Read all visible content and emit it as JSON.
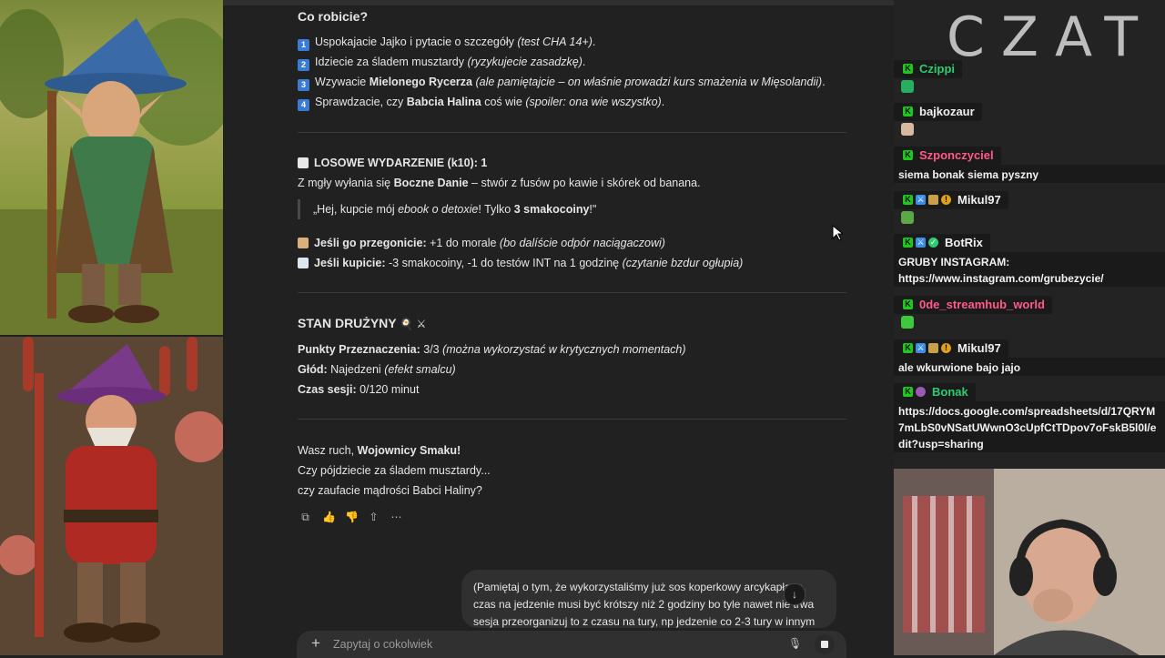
{
  "chat": {
    "section1_title": "Co robicie?",
    "options": [
      {
        "num": "1",
        "parts": [
          "Uspokajacie Jajko i pytacie o szczegóły ",
          "(test CHA 14+)",
          "."
        ]
      },
      {
        "num": "2",
        "parts": [
          "Idziecie za śladem musztardy ",
          "(ryzykujecie zasadzkę)",
          "."
        ]
      },
      {
        "num": "3",
        "pre": "Wzywacie ",
        "bold": "Mielonego Rycerza",
        "post": " ",
        "ital": "(ale pamiętajcie – on właśnie prowadzi kurs smażenia w Mięsolandii)",
        "end": "."
      },
      {
        "num": "4",
        "pre": "Sprawdzacie, czy ",
        "bold": "Babcia Halina",
        "post": " coś wie ",
        "ital": "(spoiler: ona wie wszystko)",
        "end": "."
      }
    ],
    "event_title": "LOSOWE WYDARZENIE (k10): 1",
    "event_line_pre": "Z mgły wyłania się ",
    "event_line_bold": "Boczne Danie",
    "event_line_post": " – stwór z fusów po kawie i skórek od banana.",
    "quote_pre": "„Hej, kupcie mój ",
    "quote_ital": "ebook o detoxie",
    "quote_mid": "! Tylko ",
    "quote_bold": "3 smakocoiny",
    "quote_end": "!\"",
    "if_chase_label": "Jeśli go przegonicie:",
    "if_chase_text": " +1 do morale ",
    "if_chase_ital": "(bo dalíście odpór naciągaczowi)",
    "if_buy_label": "Jeśli kupicie:",
    "if_buy_text": " -3 smakocoiny, -1 do testów INT na 1 godzinę ",
    "if_buy_ital": "(czytanie bzdur ogłupia)",
    "status_title": "STAN DRUŻYNY",
    "status_emoji": "🍳 ⚔",
    "fate_label": "Punkty Przeznaczenia:",
    "fate_value": " 3/3 ",
    "fate_ital": "(można wykorzystać w krytycznych momentach)",
    "hunger_label": "Głód:",
    "hunger_value": " Najedzeni ",
    "hunger_ital": "(efekt smalcu)",
    "session_label": "Czas sesji:",
    "session_value": " 0/120 minut",
    "closing_pre": "Wasz ruch, ",
    "closing_bold": "Wojownicy Smaku!",
    "closing_2": "Czy pójdziecie za śladem musztardy...",
    "closing_3": "czy zaufacie mądrości Babci Haliny?",
    "user_message": "(Pamiętaj o tym, że wykorzystaliśmy już sos koperkowy arcykapłana, czas na jedzenie musi być krótszy niż 2 godziny bo tyle nawet nie trwa sesja przeorganizuj to z czasu na tury, np jedzenie co 2-3 tury w innym",
    "composer_placeholder": "Zapytaj o cokolwiek",
    "scroll_arrow": "↓"
  },
  "side": {
    "header": "CZAT",
    "messages": [
      {
        "user": "Czippi",
        "color": "#2ecc71",
        "badges": [
          "k"
        ],
        "emote": "#27ae60",
        "text": ""
      },
      {
        "user": "bajkozaur",
        "color": "#f0f0f0",
        "badges": [
          "k"
        ],
        "emote": "#d8b8a0",
        "text": ""
      },
      {
        "user": "Szponczyciel",
        "color": "#ff5a8a",
        "badges": [
          "k"
        ],
        "emote": "",
        "text": "siema bonak siema pyszny"
      },
      {
        "user": "Mikul97",
        "color": "#f0f0f0",
        "badges": [
          "k",
          "a",
          "s",
          "c"
        ],
        "emote": "#5aa848",
        "text": ""
      },
      {
        "user": "BotRix",
        "color": "#f0f0f0",
        "badges": [
          "k",
          "a",
          "a"
        ],
        "emote": "",
        "text": "GRUBY INSTAGRAM: https://www.instagram.com/grubezycie/"
      },
      {
        "user": "0de_streamhub_world",
        "color": "#ff5a8a",
        "badges": [
          "k"
        ],
        "emote": "#3ec83e",
        "text": ""
      },
      {
        "user": "Mikul97",
        "color": "#f0f0f0",
        "badges": [
          "k",
          "a",
          "s",
          "c"
        ],
        "emote": "",
        "text": "ale wkurwione bajo jajo"
      },
      {
        "user": "Bonak",
        "color": "#2ecc71",
        "badges": [
          "k",
          "o"
        ],
        "emote": "",
        "text": "https://docs.google.com/spreadsheets/d/17QRYM7mLbS0vNSatUWwnO3cUpfCtTDpov7oFskB5l0I/edit?usp=sharing"
      }
    ]
  }
}
